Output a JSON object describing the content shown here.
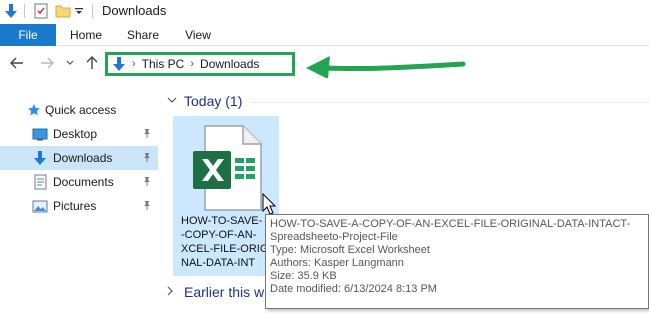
{
  "window": {
    "title": "Downloads"
  },
  "ribbon": {
    "tabs": [
      "File",
      "Home",
      "Share",
      "View"
    ]
  },
  "address_bar": {
    "crumbs": [
      "This PC",
      "Downloads"
    ]
  },
  "sidebar": {
    "quick_access_label": "Quick access",
    "items": [
      {
        "label": "Desktop",
        "icon": "desktop-icon",
        "pinned": true
      },
      {
        "label": "Downloads",
        "icon": "downloads-icon",
        "pinned": true,
        "selected": true
      },
      {
        "label": "Documents",
        "icon": "documents-icon",
        "pinned": true
      },
      {
        "label": "Pictures",
        "icon": "pictures-icon",
        "pinned": true
      }
    ]
  },
  "content": {
    "group_today": "Today (1)",
    "group_earlier": "Earlier this w",
    "file": {
      "name_lines": [
        "HOW-TO-SAVE-",
        "-COPY-OF-AN-",
        "XCEL-FILE-ORIG",
        "NAL-DATA-INT"
      ],
      "icon": "excel-file-icon"
    }
  },
  "tooltip": {
    "lines": [
      "HOW-TO-SAVE-A-COPY-OF-AN-EXCEL-FILE-ORIGINAL-DATA-INTACT-",
      "Spreadsheeto-Project-File",
      "Type: Microsoft Excel Worksheet",
      "Authors: Kasper Langmann",
      "Size: 35.9 KB",
      "Date modified: 6/13/2024 8:13 PM"
    ]
  },
  "colors": {
    "file_tab": "#1979ca",
    "selected_bg": "#cce4f7",
    "annotation_green": "#23a455",
    "excel_green": "#1d7044",
    "group_header": "#1e3287"
  }
}
